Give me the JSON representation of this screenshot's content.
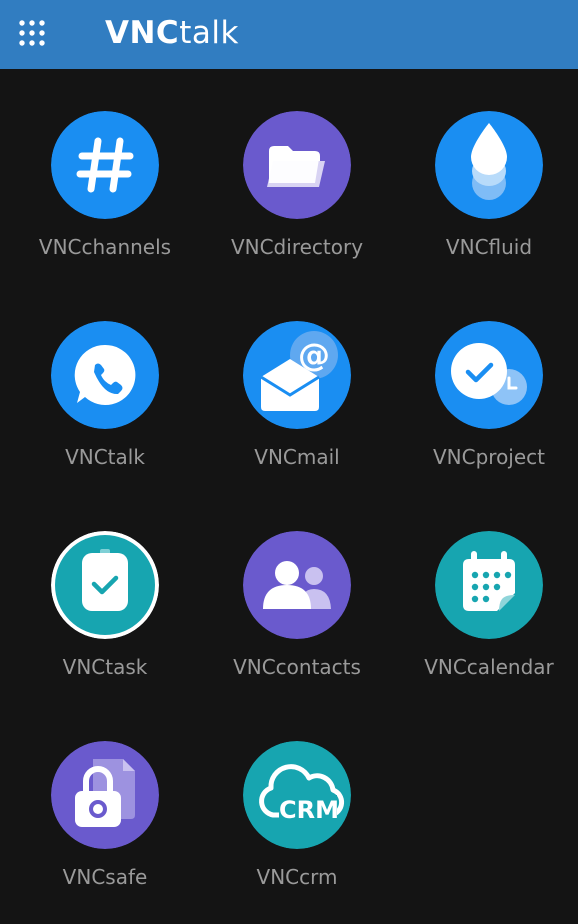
{
  "header": {
    "brand_strong": "VNC",
    "brand_light": "talk",
    "menu_icon": "apps-grid-icon",
    "background": "#317dc1"
  },
  "apps": [
    {
      "label": "VNCchannels",
      "icon": "hashtag-icon",
      "color": "#1a8ef2"
    },
    {
      "label": "VNCdirectory",
      "icon": "folder-icon",
      "color": "#6a5acd"
    },
    {
      "label": "VNCfluid",
      "icon": "drop-icon",
      "color": "#1a8ef2"
    },
    {
      "label": "VNCtalk",
      "icon": "chat-phone-icon",
      "color": "#1a8ef2"
    },
    {
      "label": "VNCmail",
      "icon": "envelope-at-icon",
      "color": "#1a8ef2"
    },
    {
      "label": "VNCproject",
      "icon": "check-clock-icon",
      "color": "#1a8ef2"
    },
    {
      "label": "VNCtask",
      "icon": "clipboard-check-icon",
      "color": "#17a5b0"
    },
    {
      "label": "VNCcontacts",
      "icon": "people-icon",
      "color": "#6a5acd"
    },
    {
      "label": "VNCcalendar",
      "icon": "calendar-icon",
      "color": "#17a5b0"
    },
    {
      "label": "VNCsafe",
      "icon": "lock-file-icon",
      "color": "#6a5acd"
    },
    {
      "label": "VNCcrm",
      "icon": "crm-cloud-icon",
      "color": "#17a5b0"
    }
  ]
}
